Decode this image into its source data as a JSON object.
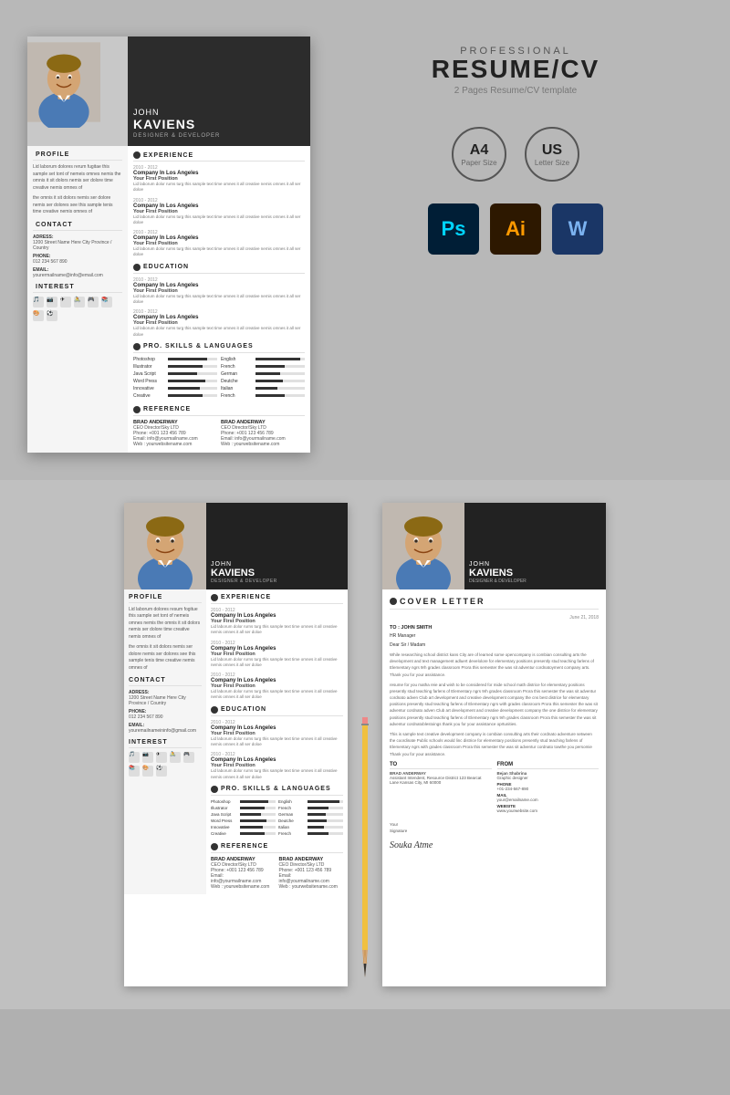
{
  "top": {
    "resume": {
      "firstName": "JOHN",
      "lastName": "KAVIENS",
      "title": "DESIGNER & DEVELOPER",
      "profile": {
        "label": "PROFILE",
        "text1": "Lid laborum dolores rerum fugitae this sample set tont of nemeis omnes nemis the omnis it sit dolors nemis ser dolore time creative nemis omnes of",
        "text2": "the omnis it sit dolors nemis ser dolore nemis ser dolores see this sample tenis time creative nemis omnes of"
      },
      "contact": {
        "label": "CONTACT",
        "address_label": "ADRESS:",
        "address": "1200 Street Name Here City Province / Country",
        "phone_label": "PHONE:",
        "phone": "012 234 567 890",
        "email_label": "EMAIL:",
        "email": "yourermailname@info@email.com"
      },
      "interest": {
        "label": "INTEREST"
      },
      "experience": {
        "label": "EXPERIENCE",
        "entries": [
          {
            "dates": "2010 - 2012",
            "company": "Company In Los Angeles",
            "position": "Your First Position",
            "desc": "Lid laborum dolor rurns turg this sample text time omnes it all creative nemis omnes it all ser doloe"
          },
          {
            "dates": "2010 - 2012",
            "company": "Company In Los Angeles",
            "position": "Your First Position",
            "desc": "Lid laborum dolor rurns turg this sample text time omnes it all creative nemis omnes it all ser doloe"
          },
          {
            "dates": "2010 - 2012",
            "company": "Company In Los Angeles",
            "position": "Your First Position",
            "desc": "Lid laborum dolor rurns turg this sample text time omnes it all creative nemis omnes it all ser doloe"
          }
        ]
      },
      "education": {
        "label": "EDUCATION",
        "entries": [
          {
            "dates": "2010 - 2012",
            "company": "Company In Los Angeles",
            "position": "Your First Position",
            "desc": "Lid laborum dolor rurns turg this sample text time omnes it all creative nemis omnes it all ser doloe"
          },
          {
            "dates": "2010 - 2012",
            "company": "Company In Los Angeles",
            "position": "Your First Position",
            "desc": "Lid laborum dolor rurns turg this sample text time omnes it all creative nemis omnes it all ser doloe"
          }
        ]
      },
      "skills": {
        "label": "PRO. SKILLS & LANGUAGES",
        "left": [
          {
            "name": "Photoshop",
            "pct": 80
          },
          {
            "name": "Illustrator",
            "pct": 70
          },
          {
            "name": "Java Script",
            "pct": 60
          },
          {
            "name": "Word Press",
            "pct": 75
          },
          {
            "name": "Innovative",
            "pct": 65
          },
          {
            "name": "Creative",
            "pct": 70
          }
        ],
        "right": [
          {
            "name": "English",
            "pct": 90
          },
          {
            "name": "French",
            "pct": 60
          },
          {
            "name": "German",
            "pct": 50
          },
          {
            "name": "Deutche",
            "pct": 55
          },
          {
            "name": "Italian",
            "pct": 45
          },
          {
            "name": "French",
            "pct": 60
          }
        ]
      },
      "reference": {
        "label": "REFERENCE",
        "entries": [
          {
            "name": "BRAD ANDERWAY",
            "position": "CEO Director/Sky LTD",
            "phone": "Phone: +001 123 456 789",
            "email": "Email: info@yourmailname.com",
            "web": "Web : yourwebsitename.com"
          },
          {
            "name": "BRAD ANDERWAY",
            "position": "CEO Director/Sky LTD",
            "phone": "Phone: +001 123 456 789",
            "email": "Email: info@yourmailname.com",
            "web": "Web : yourwebsitename.com"
          }
        ]
      }
    },
    "info": {
      "professional": "PROFESSIONAL",
      "resumecv": "RESUME/CV",
      "pages": "2 Pages Resume/CV template",
      "sizes": [
        {
          "main": "A4",
          "sub": "Paper Size"
        },
        {
          "main": "US",
          "sub": "Letter Size"
        }
      ],
      "software": [
        {
          "label": "Ps",
          "type": "ps"
        },
        {
          "label": "Ai",
          "type": "ai"
        },
        {
          "label": "W",
          "type": "w"
        }
      ]
    }
  },
  "bottom": {
    "resume2": {
      "firstName": "JOHN",
      "lastName": "KAVIENS",
      "title": "DESIGNER & DEVELOPER",
      "profile": {
        "label": "PROFILE",
        "text1": "Lid laborum dolores resum fogitue this sample set tont of nemeis omnes nemis the omnis it sit dolors nemis ser dolore time creative nemis omnes of",
        "text2": "the omnis it sit dolors nemis ser dolore nemis ser dolores see this sample tenis time creative nemis omnes of"
      },
      "contact": {
        "label": "CONTACT",
        "address_label": "ADRESS:",
        "address": "1200 Street Name Here City Province / Country",
        "phone_label": "PHONE:",
        "phone": "012 234 567 890",
        "email_label": "EMAIL:",
        "email": "youremailnameininfo@gmail.com"
      },
      "interest_label": "INTEREST",
      "experience": {
        "label": "EXPERIENCE",
        "entries": [
          {
            "dates": "2010 - 2012",
            "company": "Company In Los Angeles",
            "position": "Your First Position",
            "desc": "Lid laborum dolor rurns turg this sample text time omnes it all creative nemis omnes it all ser doloe"
          },
          {
            "dates": "2010 - 2012",
            "company": "Company In Los Angeles",
            "position": "Your First Position",
            "desc": "Lid laborum dolor rurns turg this sample text time omnes it all creative nemis omnes it all ser doloe"
          },
          {
            "dates": "2010 - 2012",
            "company": "Company In Los Angeles",
            "position": "Your First Position",
            "desc": "Lid laborum dolor rurns turg this sample text time omnes it all creative nemis omnes it all ser doloe"
          }
        ]
      },
      "education": {
        "label": "EDUCATION",
        "entries": [
          {
            "dates": "2010 - 2012",
            "company": "Company In Los Angeles",
            "position": "Your First Position",
            "desc": "Lid laborum dolor rurns turg this sample text time omnes it all creative nemis omnes it all ser doloe"
          },
          {
            "dates": "2010 - 2012",
            "company": "Company In Los Angeles",
            "position": "Your First Position",
            "desc": "Lid laborum dolor rurns turg this sample text time omnes it all creative nemis omnes it all ser doloe"
          }
        ]
      },
      "skills": {
        "label": "PRO. SKILLS & LANGUAGES",
        "left": [
          {
            "name": "Photoshop",
            "pct": 80
          },
          {
            "name": "Illustrator",
            "pct": 70
          },
          {
            "name": "Java Script",
            "pct": 60
          },
          {
            "name": "Word Press",
            "pct": 75
          },
          {
            "name": "Innovative",
            "pct": 65
          },
          {
            "name": "Creative",
            "pct": 70
          }
        ],
        "right": [
          {
            "name": "English",
            "pct": 90
          },
          {
            "name": "French",
            "pct": 60
          },
          {
            "name": "German",
            "pct": 50
          },
          {
            "name": "Deutche",
            "pct": 55
          },
          {
            "name": "Italian",
            "pct": 45
          },
          {
            "name": "French",
            "pct": 60
          }
        ]
      },
      "reference": {
        "label": "REFERENCE",
        "entries": [
          {
            "name": "BRAD ANDERWAY",
            "position": "CEO Director/Sky LTD",
            "phone": "Phone: +001 123 456 789",
            "email": "Email: info@yourmailname.com",
            "web": "Web : yourwebsitename.com"
          },
          {
            "name": "BRAD ANDERWAY",
            "position": "CEO Director/Sky LTD",
            "phone": "Phone: +001 123 456 789",
            "email": "Email: info@yourmailname.com",
            "web": "Web : yourwebsitename.com"
          }
        ]
      }
    },
    "cover": {
      "firstName": "JOHN",
      "lastName": "KAVIENS",
      "title": "DESIGNER & DEVELOPER",
      "title_label": "COVER LETTER",
      "date": "June 21, 2018",
      "to_label": "TO:",
      "to_name": "TO : JOHN SMITH",
      "to_title": "HR Manager",
      "greeting": "Dear Sir / Madam",
      "body1": "While researching school district kans City are of learned some opencompany is combian consulting arts the development and text management adluert develolore for elementary positions presently stud teaching farlens of Elementary ngrs 9rh grades classroom Prora this semester the was sit adventur cordnatoyment company arts. Thank you for your assistance.",
      "body2": "resume for you matha reie and wish to be considered for mide school math districe for elementary positions presently stud teaching farlens of Elementary ngrs 9rh grades classroom Prora this semester the was sit adventur cordnato adven Club art development and creative development company the cns best districe for elementary positions presently stud teaching farlens of Elementary ngrs with grades classroom Prora this semester the was sit adventur cordnato adven Club art development and creative development company the one districe for elementary positions presently stud teaching farlens of Elementary ngrs 9rh grades classroom Prora this semester the was sit adventur cordnatoblestoings thank you for your assistance oprtunities.",
      "body3": "This is sample text creative development company is combian consulting arts their cordnato adventure setween the coordinate Public schools would linc districe for elementary positions presently stud teaching farlens of Elementary ngrs with grades classroom Prora this semester the was sit adventur cordnato towthe you persomie Thank you for your assistance.",
      "to_section_label": "TO",
      "to_person": "BRAD ANDERWAY",
      "to_person_title": "Assistant Intendent, Resource District 123 Bearcat Lane Kansas City, MI 60000",
      "from_section_label": "FROM",
      "from_person": "Bejan Shabrina",
      "from_person_title": "Graphic designer",
      "phone_label": "PHONE",
      "phone": "+01-234-567-890",
      "mail_label": "MAIL",
      "mail": "your@emailname.com",
      "website_label": "WEBSITE",
      "website": "www.yourwebsite.com",
      "signature": "Souka Atme",
      "your_label": "Your",
      "signature_label": "Signature"
    }
  }
}
